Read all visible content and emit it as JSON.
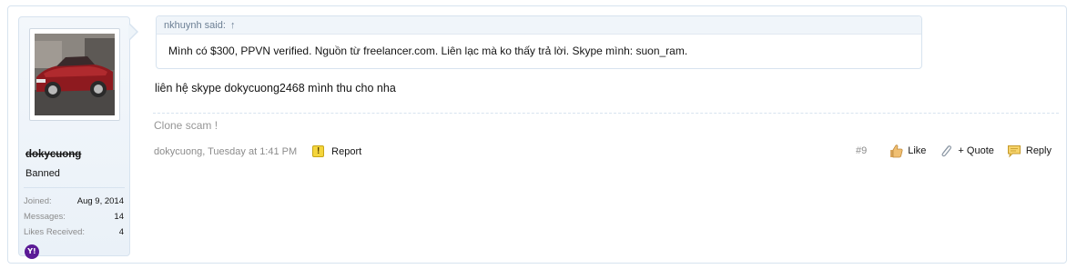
{
  "user": {
    "username": "dokycuong",
    "title": "Banned",
    "stats": [
      {
        "label": "Joined:",
        "value": "Aug 9, 2014"
      },
      {
        "label": "Messages:",
        "value": "14"
      },
      {
        "label": "Likes Received:",
        "value": "4"
      }
    ],
    "contact_icon": "yahoo-messenger-icon",
    "contact_icon_text": "Y!"
  },
  "quote": {
    "author": "nkhuynh said:",
    "arrow": "↑",
    "text": "Mình có $300, PPVN verified. Nguồn từ freelancer.com. Liên lạc mà ko thấy trả lời. Skype mình: suon_ram."
  },
  "message": {
    "text": "liên hệ skype dokycuong2468 mình thu cho nha",
    "signature": "Clone scam !"
  },
  "meta": {
    "author_date": "dokycuong, Tuesday at 1:41 PM",
    "report_label": "Report",
    "post_number": "#9",
    "like_label": "Like",
    "quote_label": "+ Quote",
    "reply_label": "Reply"
  },
  "colors": {
    "border": "#d7e3ef",
    "panel_bg": "#eef4f9",
    "muted_text": "#8c8c8c",
    "yahoo_purple": "#5b1a96",
    "report_yellow": "#f4d53c"
  }
}
